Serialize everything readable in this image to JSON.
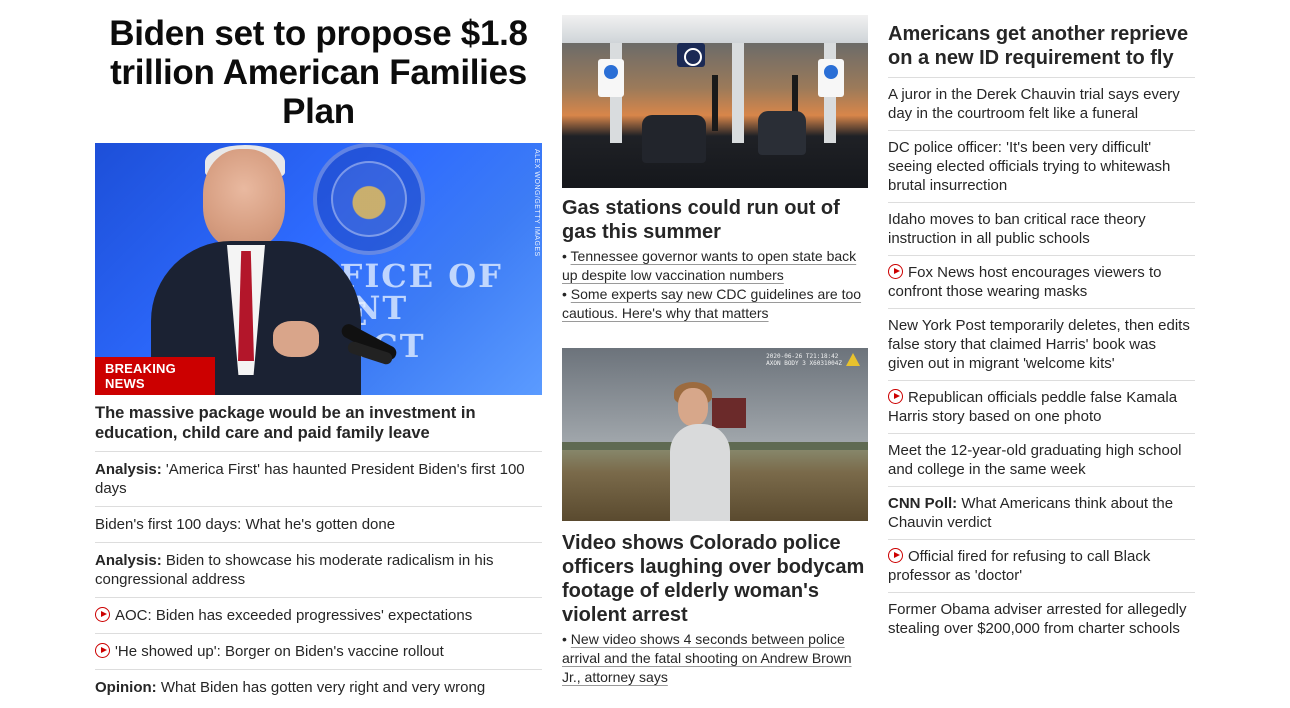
{
  "lead": {
    "headline": "Biden set to propose $1.8 trillion American Families Plan",
    "image_credit": "ALEX WONG/GETTY IMAGES",
    "image_text": {
      "line1": "OFFICE OF THE",
      "line2": "DENT ELECT",
      "line3": "DENT"
    },
    "badge": "BREAKING NEWS",
    "deck": "The massive package would be an investment in education, child care and paid family leave",
    "items": [
      {
        "label": "Analysis:",
        "text": " 'America First' has haunted President Biden's first 100 days",
        "video": false
      },
      {
        "label": "",
        "text": "Biden's first 100 days: What he's gotten done",
        "video": false
      },
      {
        "label": "Analysis:",
        "text": " Biden to showcase his moderate radicalism in his congressional address",
        "video": false
      },
      {
        "label": "",
        "text": "AOC: Biden has exceeded progressives' expectations",
        "video": true
      },
      {
        "label": "",
        "text": "'He showed up': Borger on Biden's vaccine rollout",
        "video": true
      },
      {
        "label": "Opinion:",
        "text": " What Biden has gotten very right and very wrong",
        "video": false
      }
    ]
  },
  "middle": {
    "story1": {
      "headline": "Gas stations could run out of gas this summer",
      "bullets": [
        "Tennessee governor wants to open state back up despite low vaccination numbers",
        "Some experts say new CDC guidelines are too cautious. Here's why that matters"
      ]
    },
    "story2": {
      "cam_text": "2020-06-26 T21:18:42\nAXON BODY 3 X6031004Z",
      "headline": "Video shows Colorado police officers laughing over bodycam footage of elderly woman's violent arrest",
      "bullets": [
        "New video shows 4 seconds between police arrival and the fatal shooting on Andrew Brown Jr., attorney says"
      ]
    }
  },
  "right": {
    "headline": "Americans get another reprieve on a new ID requirement to fly",
    "items": [
      {
        "label": "",
        "text": "A juror in the Derek Chauvin trial says every day in the courtroom felt like a funeral",
        "video": false
      },
      {
        "label": "",
        "text": "DC police officer: 'It's been very difficult' seeing elected officials trying to whitewash brutal insurrection",
        "video": false
      },
      {
        "label": "",
        "text": "Idaho moves to ban critical race theory instruction in all public schools",
        "video": false
      },
      {
        "label": "",
        "text": "Fox News host encourages viewers to confront those wearing masks",
        "video": true
      },
      {
        "label": "",
        "text": "New York Post temporarily deletes, then edits false story that claimed Harris' book was given out in migrant 'welcome kits'",
        "video": false
      },
      {
        "label": "",
        "text": "Republican officials peddle false Kamala Harris story based on one photo",
        "video": true
      },
      {
        "label": "",
        "text": "Meet the 12-year-old graduating high school and college in the same week",
        "video": false
      },
      {
        "label": "CNN Poll:",
        "text": " What Americans think about the Chauvin verdict",
        "video": false
      },
      {
        "label": "",
        "text": "Official fired for refusing to call Black professor as 'doctor'",
        "video": true
      },
      {
        "label": "",
        "text": "Former Obama adviser arrested for allegedly stealing over $200,000 from charter schools",
        "video": false
      }
    ]
  },
  "colors": {
    "accent": "#cc0000",
    "text": "#262626",
    "divider": "#dddddd"
  },
  "icons": {
    "video": "play-circle-icon"
  }
}
